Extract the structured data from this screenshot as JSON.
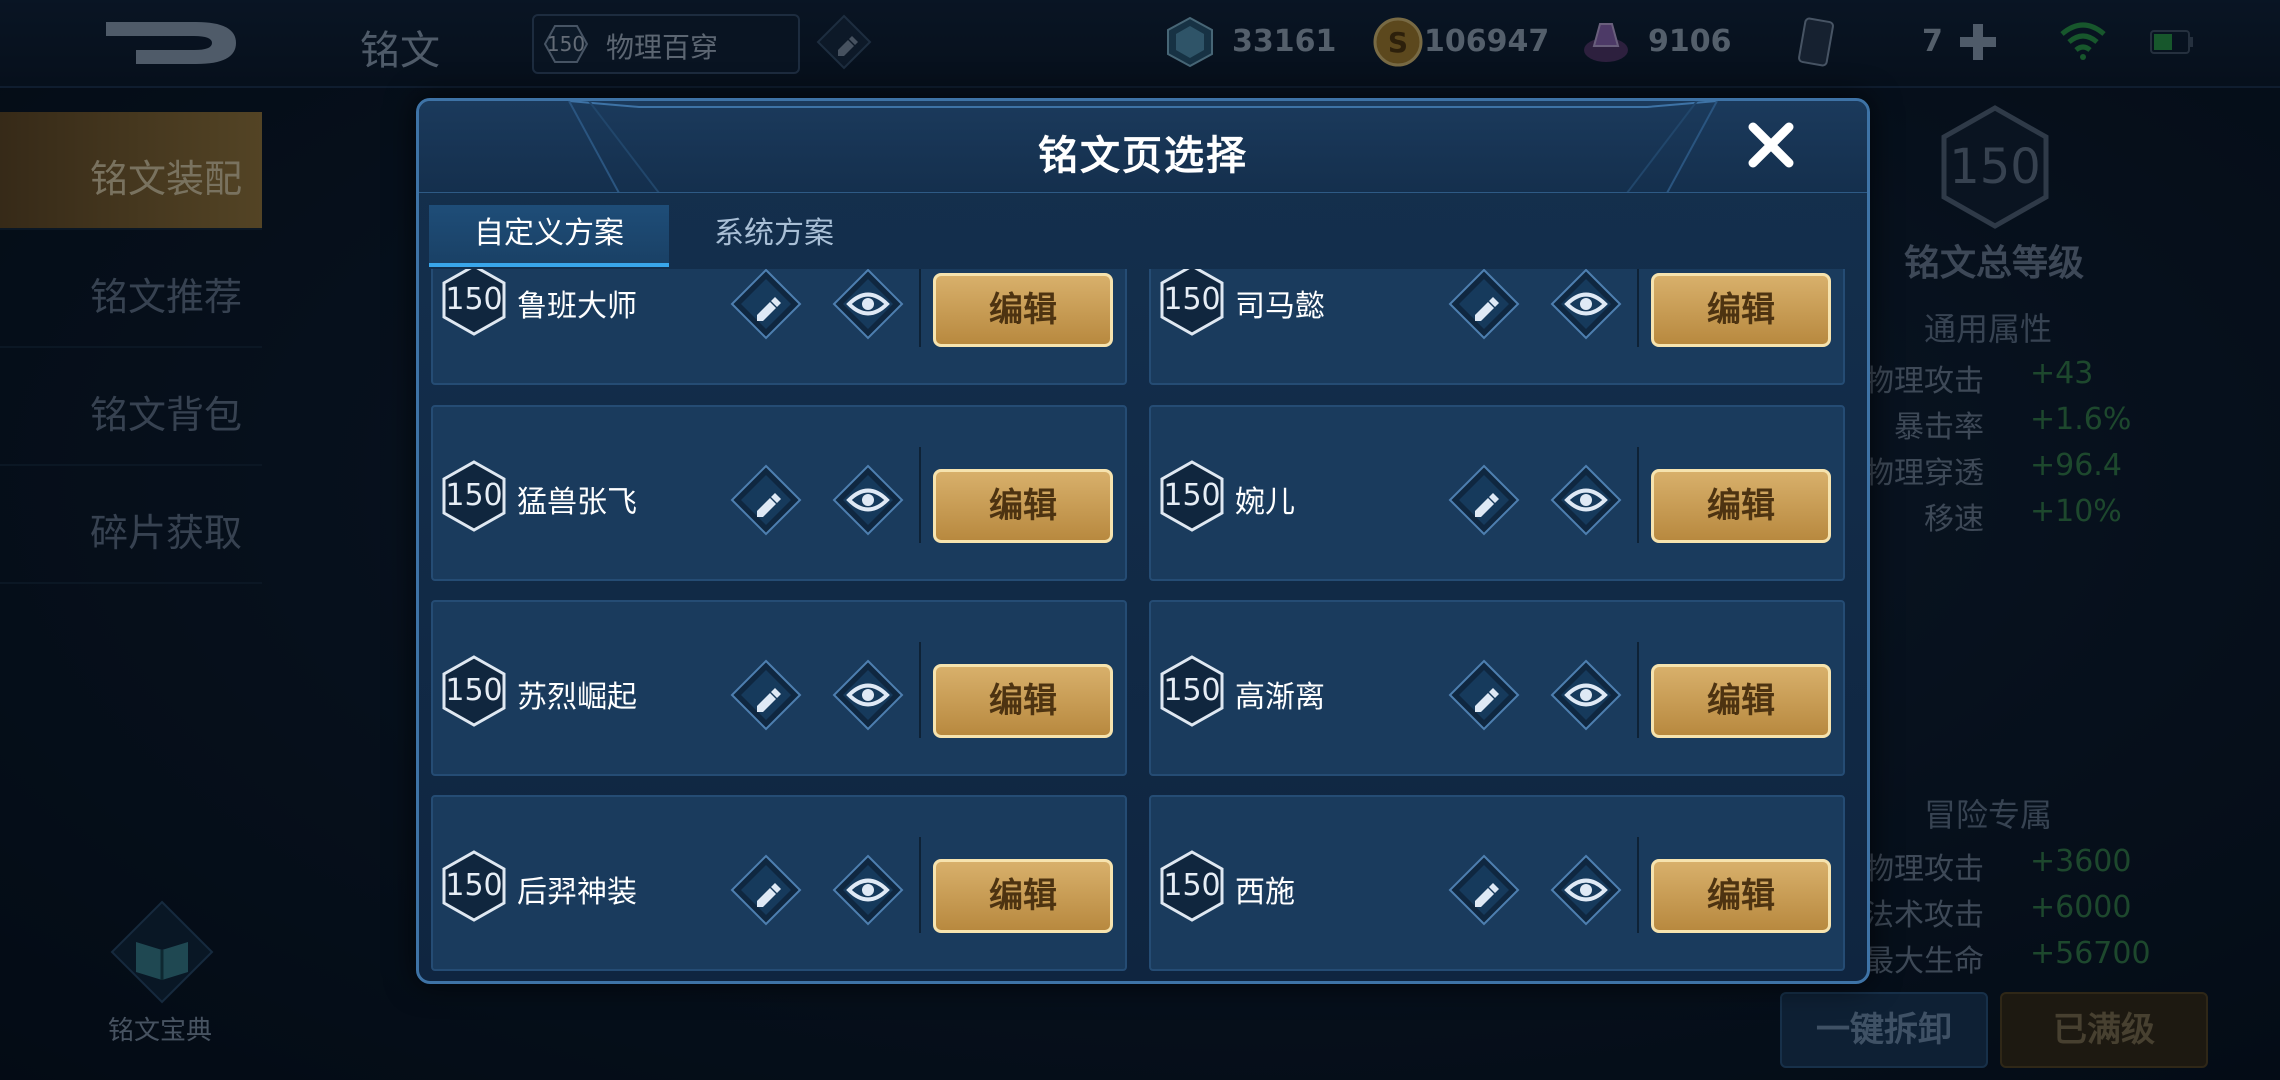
{
  "header": {
    "page_title": "铭文",
    "preset_level": "150",
    "preset_name": "物理百穿",
    "currencies": [
      {
        "icon": "cube-gem-icon",
        "value": "33161"
      },
      {
        "icon": "gold-coin-icon",
        "value": "106947"
      },
      {
        "icon": "inscription-crystal-icon",
        "value": "9106"
      },
      {
        "icon": "card-ticket-icon",
        "value": "7"
      }
    ]
  },
  "sidebar": {
    "items": [
      {
        "label": "铭文装配",
        "active": true
      },
      {
        "label": "铭文推荐",
        "active": false
      },
      {
        "label": "铭文背包",
        "active": false
      },
      {
        "label": "碎片获取",
        "active": false
      }
    ],
    "codex_label": "铭文宝典"
  },
  "right_panel": {
    "total_level": "150",
    "total_level_label": "铭文总等级",
    "general_title": "通用属性",
    "general_stats": [
      {
        "name": "物理攻击",
        "value": "+43"
      },
      {
        "name": "暴击率",
        "value": "+1.6%"
      },
      {
        "name": "物理穿透",
        "value": "+96.4"
      },
      {
        "name": "移速",
        "value": "+10%"
      }
    ],
    "adventure_title": "冒险专属",
    "adventure_stats": [
      {
        "name": "物理攻击",
        "value": "+3600"
      },
      {
        "name": "法术攻击",
        "value": "+6000"
      },
      {
        "name": "最大生命",
        "value": "+56700"
      }
    ],
    "unequip_label": "一键拆卸",
    "maxed_label": "已满级"
  },
  "modal": {
    "title": "铭文页选择",
    "tabs": [
      {
        "label": "自定义方案",
        "active": true
      },
      {
        "label": "系统方案",
        "active": false
      }
    ],
    "edit_label": "编辑",
    "pages": [
      {
        "level": "150",
        "name": "鲁班大师"
      },
      {
        "level": "150",
        "name": "司马懿"
      },
      {
        "level": "150",
        "name": "猛兽张飞"
      },
      {
        "level": "150",
        "name": "婉儿"
      },
      {
        "level": "150",
        "name": "苏烈崛起"
      },
      {
        "level": "150",
        "name": "高渐离"
      },
      {
        "level": "150",
        "name": "后羿神装"
      },
      {
        "level": "150",
        "name": "西施"
      }
    ]
  },
  "colors": {
    "accent_blue": "#39a6ea",
    "gold_button": "#c99a50",
    "stat_green": "#3b8a4c"
  }
}
